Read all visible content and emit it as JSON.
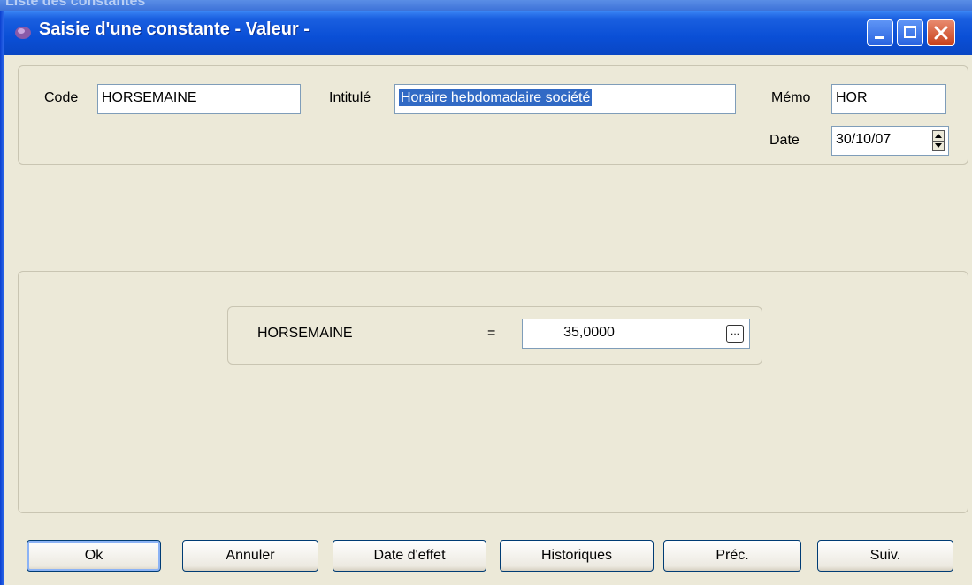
{
  "background_window": {
    "title": "Liste des constantes"
  },
  "window": {
    "title": "Saisie d'une constante - Valeur -",
    "controls": {
      "minimize": "minimize-icon",
      "maximize": "maximize-icon",
      "close": "close-icon"
    }
  },
  "header": {
    "code": {
      "label": "Code",
      "value": "HORSEMAINE"
    },
    "intitule": {
      "label": "Intitulé",
      "value": "Horaire hebdomadaire société"
    },
    "memo": {
      "label": "Mémo",
      "value": "HOR"
    },
    "date": {
      "label": "Date",
      "value": "30/10/07"
    }
  },
  "value_panel": {
    "name": "HORSEMAINE",
    "equals": "=",
    "value": "35,0000",
    "browse_label": "..."
  },
  "buttons": {
    "ok": "Ok",
    "annuler": "Annuler",
    "date_effet": "Date d'effet",
    "historiques": "Historiques",
    "prec": "Préc.",
    "suiv": "Suiv."
  },
  "colors": {
    "titlebar": "#0a4fd6",
    "selection": "#316ac5",
    "window_bg": "#ece9d8",
    "close_button": "#c8421d"
  }
}
